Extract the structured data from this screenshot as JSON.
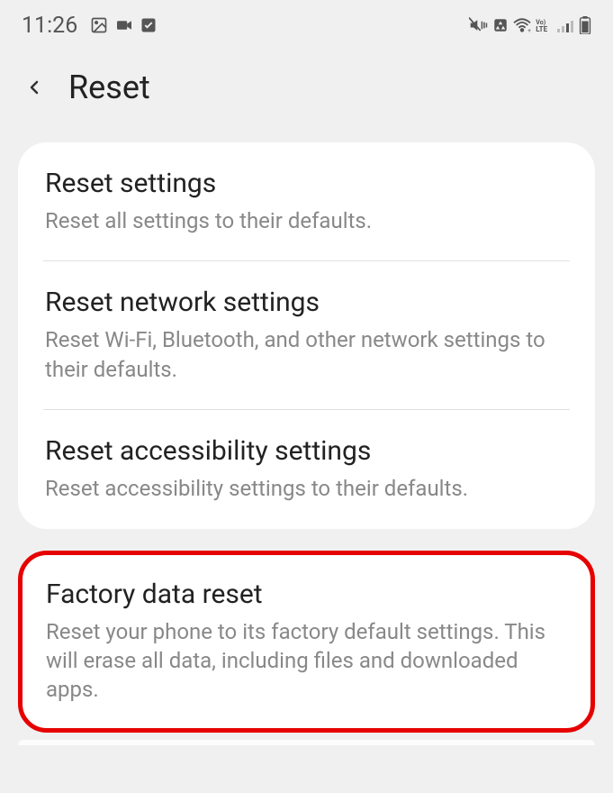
{
  "statusBar": {
    "time": "11:26"
  },
  "header": {
    "title": "Reset"
  },
  "group1": {
    "items": [
      {
        "title": "Reset settings",
        "subtitle": "Reset all settings to their defaults."
      },
      {
        "title": "Reset network settings",
        "subtitle": "Reset Wi-Fi, Bluetooth, and other network settings to their defaults."
      },
      {
        "title": "Reset accessibility settings",
        "subtitle": "Reset accessibility settings to their defaults."
      }
    ]
  },
  "group2": {
    "items": [
      {
        "title": "Factory data reset",
        "subtitle": "Reset your phone to its factory default settings. This will erase all data, including files and downloaded apps."
      }
    ]
  }
}
